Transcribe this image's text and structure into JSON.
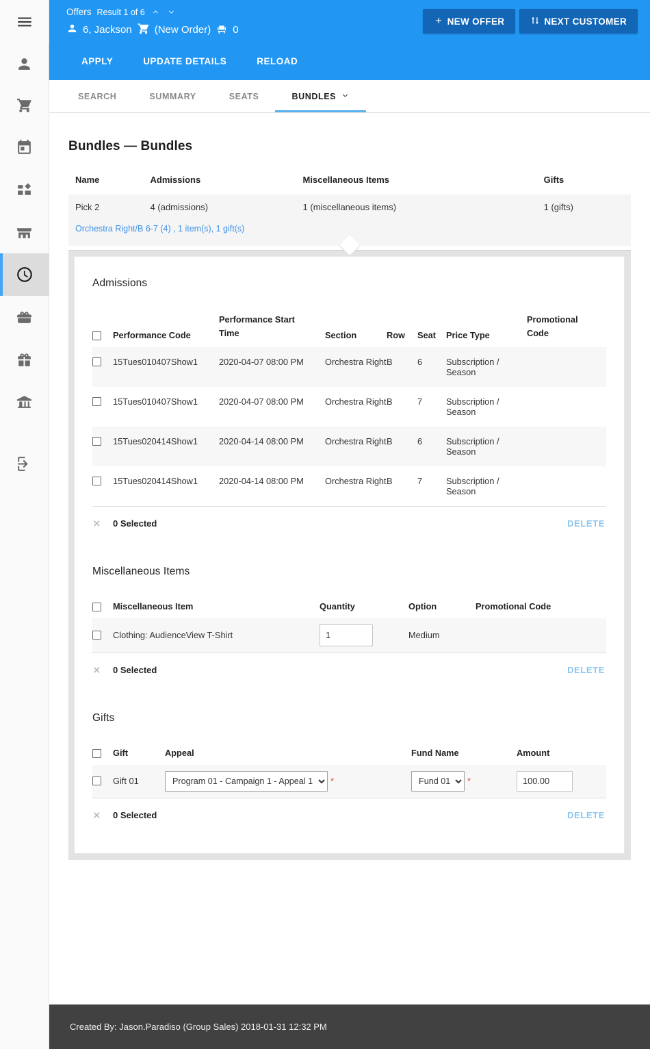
{
  "sidebar": {
    "items": [
      {
        "name": "menu-icon",
        "label": "Menu"
      },
      {
        "name": "person-icon",
        "label": "Customer"
      },
      {
        "name": "shopping-cart-icon",
        "label": "Cart"
      },
      {
        "name": "calendar-icon",
        "label": "Calendar"
      },
      {
        "name": "dashboard-icon",
        "label": "Dashboard"
      },
      {
        "name": "store-icon",
        "label": "Store"
      },
      {
        "name": "clock-icon",
        "label": "History"
      },
      {
        "name": "ticket-icon",
        "label": "Tickets"
      },
      {
        "name": "gift-icon",
        "label": "Gifts"
      },
      {
        "name": "bank-icon",
        "label": "Institution"
      },
      {
        "name": "logout-icon",
        "label": "Log Out"
      }
    ],
    "active_index": 6
  },
  "header": {
    "section_label": "Offers",
    "result_text": "Result 1 of 6",
    "customer_name": "6, Jackson",
    "order_label": "(New Order)",
    "seat_count": "0",
    "new_offer_button": "NEW OFFER",
    "new_offer_icon": "plus-icon",
    "next_customer_button": "NEXT CUSTOMER",
    "next_customer_icon": "swap-vertical-icon",
    "bg_color": "#2196f3",
    "button_color": "#1266b5"
  },
  "actionbar": {
    "buttons": [
      "APPLY",
      "UPDATE DETAILS",
      "RELOAD"
    ]
  },
  "tabs": {
    "items": [
      {
        "label": "SEARCH",
        "active": false,
        "caret": false
      },
      {
        "label": "SUMMARY",
        "active": false,
        "caret": false
      },
      {
        "label": "SEATS",
        "active": false,
        "caret": false
      },
      {
        "label": "BUNDLES",
        "active": true,
        "caret": true
      }
    ],
    "accent_color": "#57b2f0"
  },
  "main": {
    "page_title": "Bundles — Bundles",
    "bundle_table": {
      "headers": [
        "Name",
        "Admissions",
        "Miscellaneous Items",
        "Gifts"
      ],
      "row": {
        "name": "Pick 2",
        "admissions": "4 (admissions)",
        "miscellaneous": "1 (miscellaneous items)",
        "gifts": "1 (gifts)"
      },
      "sub_link": "Orchestra Right/B 6-7 (4) , 1 item(s), 1 gift(s)",
      "link_color": "#3f93e8"
    },
    "admissions": {
      "title": "Admissions",
      "headers": [
        "Performance Code",
        "Performance Start Time",
        "Section",
        "Row",
        "Seat",
        "Price Type",
        "Promotional Code"
      ],
      "rows": [
        {
          "code": "15Tues010407Show1",
          "time": "2020-04-07 08:00 PM",
          "section": "Orchestra Right",
          "row": "B",
          "seat": "6",
          "price_type": "Subscription / Season",
          "promo": ""
        },
        {
          "code": "15Tues010407Show1",
          "time": "2020-04-07 08:00 PM",
          "section": "Orchestra Right",
          "row": "B",
          "seat": "7",
          "price_type": "Subscription / Season",
          "promo": ""
        },
        {
          "code": "15Tues020414Show1",
          "time": "2020-04-14 08:00 PM",
          "section": "Orchestra Right",
          "row": "B",
          "seat": "6",
          "price_type": "Subscription / Season",
          "promo": ""
        },
        {
          "code": "15Tues020414Show1",
          "time": "2020-04-14 08:00 PM",
          "section": "Orchestra Right",
          "row": "B",
          "seat": "7",
          "price_type": "Subscription / Season",
          "promo": ""
        }
      ],
      "selected_text": "0 Selected",
      "delete_label": "DELETE"
    },
    "miscellaneous": {
      "title": "Miscellaneous Items",
      "headers": [
        "Miscellaneous Item",
        "Quantity",
        "Option",
        "Promotional Code"
      ],
      "rows": [
        {
          "item": "Clothing: AudienceView T-Shirt",
          "quantity": "1",
          "option": "Medium",
          "promo": ""
        }
      ],
      "selected_text": "0 Selected",
      "delete_label": "DELETE"
    },
    "gifts": {
      "title": "Gifts",
      "headers": [
        "Gift",
        "Appeal",
        "Fund Name",
        "Amount"
      ],
      "rows": [
        {
          "gift": "Gift 01",
          "appeal": "Program 01 - Campaign 1 - Appeal 1",
          "appeal_options": [
            "Program 01 - Campaign 1 - Appeal 1"
          ],
          "fund": "Fund 01",
          "fund_options": [
            "Fund 01"
          ],
          "amount": "100.00",
          "required_marker": "*"
        }
      ],
      "selected_text": "0 Selected",
      "delete_label": "DELETE"
    }
  },
  "footer": {
    "text": "Created By: Jason.Paradiso (Group Sales) 2018-01-31 12:32 PM",
    "bg_color": "#414141"
  }
}
